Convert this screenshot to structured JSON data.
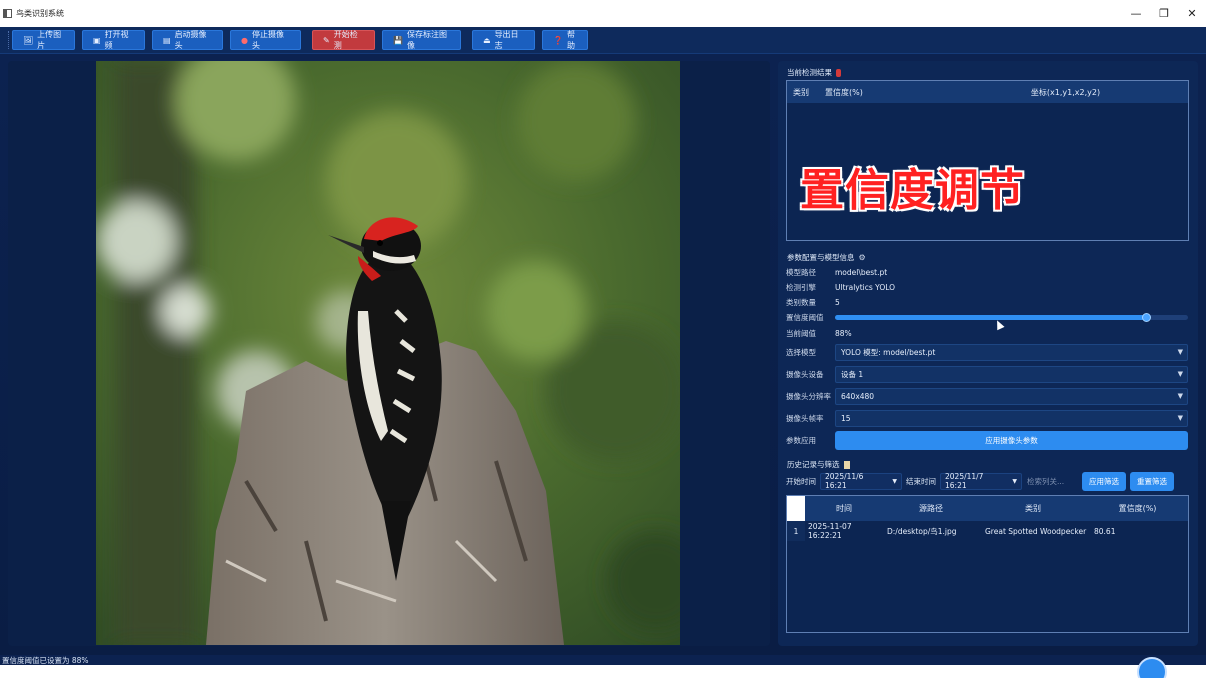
{
  "window": {
    "title": "鸟类识别系统",
    "controls": [
      "minimize-icon",
      "restore-icon",
      "close-icon"
    ]
  },
  "toolbar": {
    "buttons": [
      {
        "label": "上传图片",
        "icon": "image-icon"
      },
      {
        "label": "打开视频",
        "icon": "video-icon"
      },
      {
        "label": "启动摄像头",
        "icon": "camera-icon"
      },
      {
        "label": "停止摄像头",
        "icon": "stop-icon"
      },
      {
        "label": "开始检测",
        "icon": "pen-icon",
        "color": "#c23a3e"
      },
      {
        "label": "保存标注图像",
        "icon": "save-icon"
      },
      {
        "label": "导出日志",
        "icon": "export-icon"
      },
      {
        "label": "帮助",
        "icon": "help-icon"
      }
    ]
  },
  "results": {
    "title": "当前检测结果",
    "columns": [
      "类别",
      "置信度(%)",
      "坐标(x1,y1,x2,y2)"
    ],
    "rows": []
  },
  "overlay_caption": "置信度调节",
  "params": {
    "title": "参数配置与模型信息",
    "model_path_label": "模型路径",
    "model_path": "model\\best.pt",
    "engine_label": "检测引擎",
    "engine": "Ultralytics YOLO",
    "class_count_label": "类别数量",
    "class_count": "5",
    "threshold_label": "置信度阈值",
    "threshold_value": 0.88,
    "current_threshold_label": "当前阈值",
    "current_threshold": "88%",
    "model_select_label": "选择模型",
    "model_select_value": "YOLO 模型: model/best.pt",
    "camera_device_label": "摄像头设备",
    "camera_device_value": "设备 1",
    "resolution_label": "摄像头分辨率",
    "resolution_value": "640x480",
    "fps_label": "摄像头帧率",
    "fps_value": "15",
    "apply_label": "参数应用",
    "apply_button": "应用摄像头参数"
  },
  "history": {
    "title": "历史记录与筛选",
    "start_label": "开始时间",
    "start_value": "2025/11/6 16:21",
    "end_label": "结束时间",
    "end_value": "2025/11/7 16:21",
    "search_placeholder": "检索列关...",
    "apply_filter_button": "应用筛选",
    "reset_filter_button": "重置筛选",
    "columns": [
      "时间",
      "源路径",
      "类别",
      "置信度(%)"
    ],
    "rows": [
      {
        "index": "1",
        "time": "2025-11-07 16:22:21",
        "path": "D:/desktop/鸟1.jpg",
        "class": "Great Spotted Woodpecker",
        "confidence": "80.61"
      }
    ]
  },
  "status": {
    "message": "置信度阈值已设置为 88%"
  }
}
